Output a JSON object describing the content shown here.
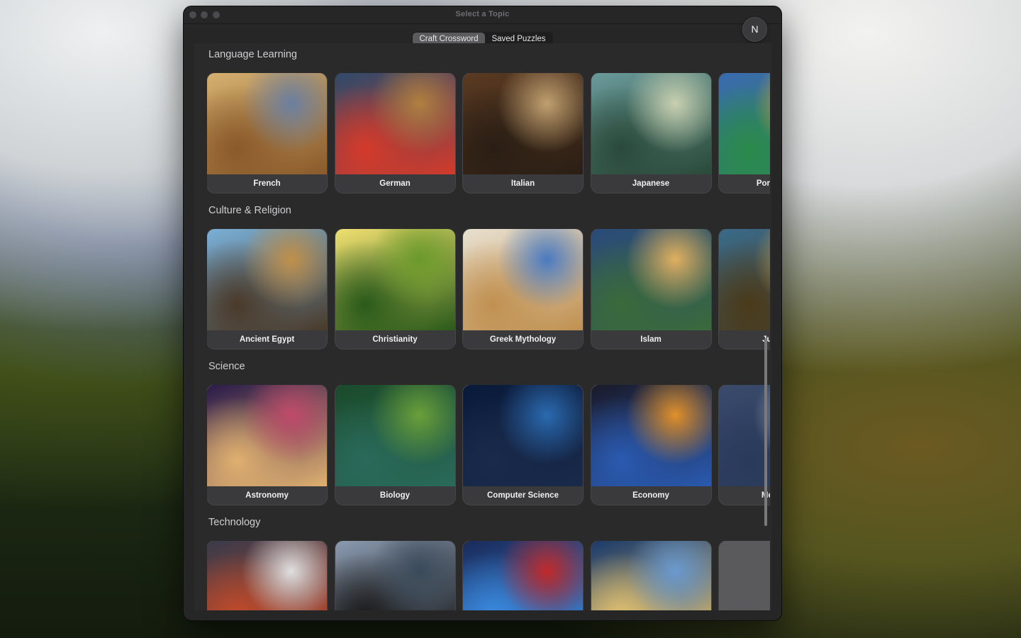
{
  "window": {
    "title": "Select a Topic"
  },
  "tabs": [
    {
      "label": "Craft Crossword",
      "active": true
    },
    {
      "label": "Saved Puzzles",
      "active": false
    }
  ],
  "avatar": {
    "initial": "N"
  },
  "sections": [
    {
      "title": "Language Learning",
      "cards": [
        {
          "label": "French",
          "colors": [
            "#d4b070",
            "#6a7fa0",
            "#8a5a2a"
          ]
        },
        {
          "label": "German",
          "colors": [
            "#2e4a6a",
            "#b08040",
            "#d43a2a"
          ]
        },
        {
          "label": "Italian",
          "colors": [
            "#5a3a22",
            "#c0a070",
            "#2a1e14"
          ]
        },
        {
          "label": "Japanese",
          "colors": [
            "#6a9a9a",
            "#c8d0b0",
            "#2a4a3a"
          ]
        },
        {
          "label": "Portuguese",
          "colors": [
            "#3a6ab0",
            "#e0a030",
            "#2a8a4a"
          ]
        }
      ]
    },
    {
      "title": "Culture & Religion",
      "cards": [
        {
          "label": "Ancient Egypt",
          "colors": [
            "#7ab0d8",
            "#c0904a",
            "#4a3a2a"
          ]
        },
        {
          "label": "Christianity",
          "colors": [
            "#f0e070",
            "#6a9a2a",
            "#2a5a1a"
          ]
        },
        {
          "label": "Greek Mythology",
          "colors": [
            "#e8e0d0",
            "#4a7ac0",
            "#c09050"
          ]
        },
        {
          "label": "Islam",
          "colors": [
            "#2a4a7a",
            "#e0b060",
            "#3a6a3a"
          ]
        },
        {
          "label": "Judaism",
          "colors": [
            "#3a6a8a",
            "#c8a050",
            "#4a3a1a"
          ]
        }
      ]
    },
    {
      "title": "Science",
      "cards": [
        {
          "label": "Astronomy",
          "colors": [
            "#2a1a4a",
            "#c04a6a",
            "#e0b070"
          ]
        },
        {
          "label": "Biology",
          "colors": [
            "#1a4a2a",
            "#6aa03a",
            "#2a6a5a"
          ]
        },
        {
          "label": "Computer Science",
          "colors": [
            "#0a1a3a",
            "#2a6ab0",
            "#1a2a4a"
          ]
        },
        {
          "label": "Economy",
          "colors": [
            "#1a1a2a",
            "#e0902a",
            "#2a5ab0"
          ]
        },
        {
          "label": "Medicine",
          "colors": [
            "#3a4a6a",
            "#a0b0c0",
            "#2a3a5a"
          ]
        }
      ]
    },
    {
      "title": "Technology",
      "cards": [
        {
          "label": "",
          "colors": [
            "#3a3a4a",
            "#e0e0e0",
            "#c04a2a"
          ]
        },
        {
          "label": "",
          "colors": [
            "#8a9ab0",
            "#3a4a5a",
            "#1a1a1a"
          ]
        },
        {
          "label": "",
          "colors": [
            "#1a2a5a",
            "#c02a2a",
            "#3a8ae0"
          ]
        },
        {
          "label": "",
          "colors": [
            "#1a3a6a",
            "#6a9ad0",
            "#e0c070"
          ]
        },
        {
          "label": "",
          "colors": [
            "#5a5a5c",
            "#5a5a5c",
            "#5a5a5c"
          ]
        }
      ]
    }
  ]
}
